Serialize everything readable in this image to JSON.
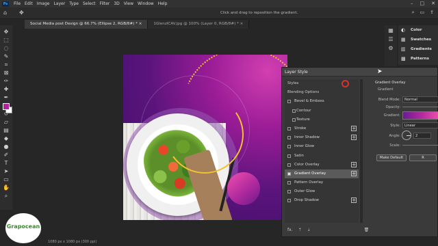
{
  "app": {
    "logo_text": "Ps"
  },
  "menu": [
    "File",
    "Edit",
    "Image",
    "Layer",
    "Type",
    "Select",
    "Filter",
    "3D",
    "View",
    "Window",
    "Help"
  ],
  "window_controls": [
    "–",
    "□",
    "✕"
  ],
  "options_bar": {
    "hint": "Click and drag to reposition the gradient.",
    "right_icons": [
      "search-icon",
      "workspace-icon",
      "share-icon"
    ]
  },
  "tabs": [
    {
      "label": "Social Media post Design @ 66.7% (Ellipse 2, RGB/8#) *",
      "active": true
    },
    {
      "label": "1GlenzICAV.jpg @ 100% (Layer 0, RGB/8#) *",
      "active": false
    }
  ],
  "tab_close": "×",
  "toolbar": {
    "tools": [
      "move",
      "marquee",
      "lasso",
      "quick-select",
      "crop",
      "frame",
      "eyedropper",
      "healing",
      "brush",
      "clone-stamp",
      "history-brush",
      "eraser",
      "gradient",
      "blur",
      "dodge",
      "pen",
      "type",
      "path-select",
      "rectangle",
      "hand",
      "zoom"
    ],
    "foreground_color": "#b0239a",
    "background_color": "#ffffff"
  },
  "right_dock": {
    "panels": [
      {
        "label": "Color",
        "icon": "color-wheel-icon"
      },
      {
        "label": "Swatches",
        "icon": "grid-icon"
      },
      {
        "label": "Gradients",
        "icon": "gradient-icon"
      },
      {
        "label": "Patterns",
        "icon": "pattern-icon"
      }
    ]
  },
  "status": "1080 px x 1080 px (300 ppi)",
  "logo": {
    "name": "Grapocean",
    "tagline": ""
  },
  "dialog": {
    "title": "Layer Style",
    "effects": [
      {
        "label": "Styles",
        "kind": "heading"
      },
      {
        "label": "Blending Options",
        "kind": "heading"
      },
      {
        "label": "Bevel & Emboss",
        "kind": "check",
        "checked": false,
        "plus": false
      },
      {
        "label": "Contour",
        "kind": "indent",
        "checked": false,
        "plus": false
      },
      {
        "label": "Texture",
        "kind": "indent",
        "checked": false,
        "plus": false
      },
      {
        "label": "Stroke",
        "kind": "check",
        "checked": false,
        "plus": true
      },
      {
        "label": "Inner Shadow",
        "kind": "check",
        "checked": false,
        "plus": true
      },
      {
        "label": "Inner Glow",
        "kind": "check",
        "checked": false,
        "plus": false
      },
      {
        "label": "Satin",
        "kind": "check",
        "checked": false,
        "plus": false
      },
      {
        "label": "Color Overlay",
        "kind": "check",
        "checked": false,
        "plus": true
      },
      {
        "label": "Gradient Overlay",
        "kind": "check",
        "checked": true,
        "plus": true,
        "selected": true
      },
      {
        "label": "Pattern Overlay",
        "kind": "check",
        "checked": false,
        "plus": false
      },
      {
        "label": "Outer Glow",
        "kind": "check",
        "checked": false,
        "plus": false
      },
      {
        "label": "Drop Shadow",
        "kind": "check",
        "checked": false,
        "plus": true
      }
    ],
    "footer": {
      "fx": "fx.",
      "up": "⇡",
      "down": "⇣",
      "trash": "🗑"
    },
    "props": {
      "section": "Gradient Overlay",
      "subsection": "Gradient",
      "blend_mode_label": "Blend Mode:",
      "blend_mode": "Normal",
      "opacity_label": "Opacity:",
      "gradient_label": "Gradient:",
      "style_label": "Style:",
      "style": "Linear",
      "angle_label": "Angle:",
      "angle": "2",
      "scale_label": "Scale:",
      "make_default": "Make Default",
      "reset": "R"
    }
  }
}
